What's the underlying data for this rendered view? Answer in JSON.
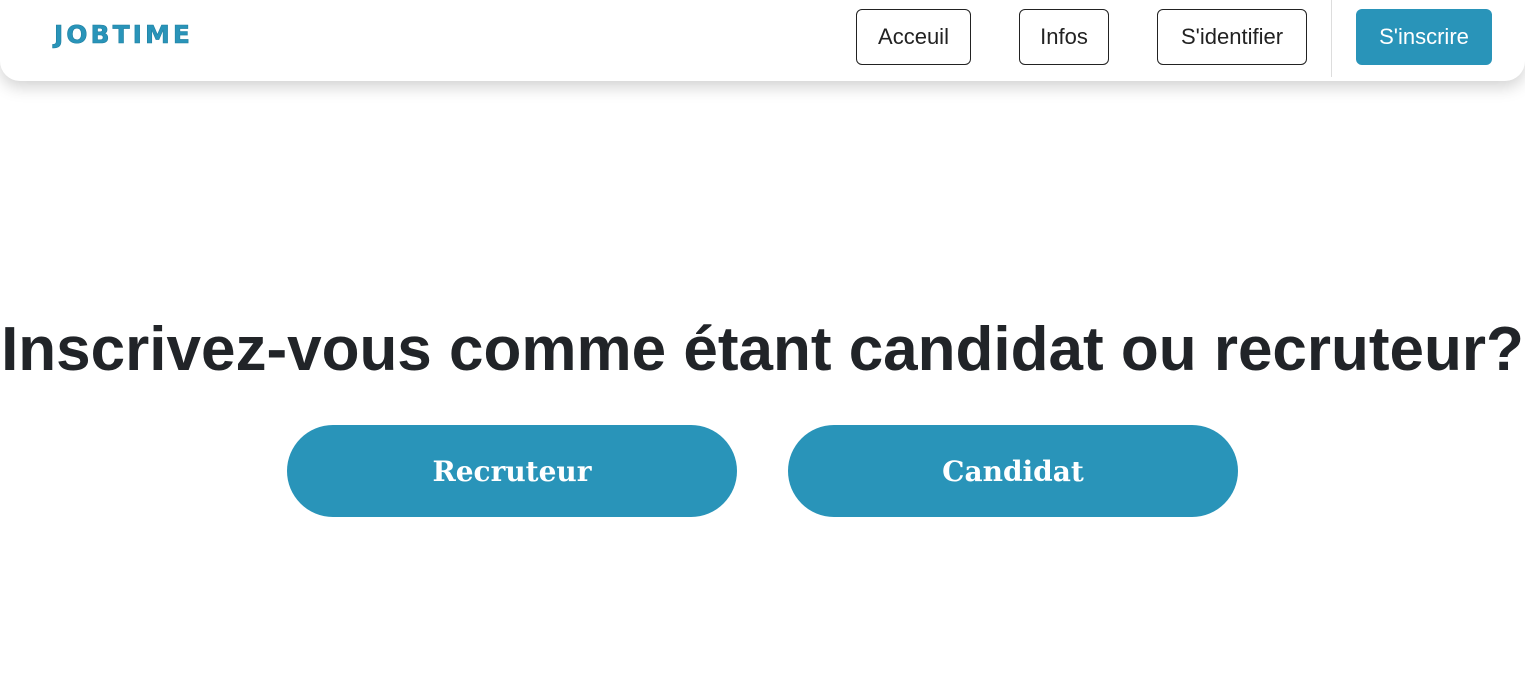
{
  "header": {
    "logo_text": "JOBTIME",
    "nav": {
      "acceuil_label": "Acceuil",
      "infos_label": "Infos",
      "identifier_label": "S'identifier",
      "inscrire_label": "S'inscrire"
    }
  },
  "main": {
    "headline": "Inscrivez-vous comme étant candidat ou recruteur?",
    "recruteur_label": "Recruteur",
    "candidat_label": "Candidat"
  },
  "colors": {
    "accent": "#2994b9",
    "headline_text": "#212428",
    "background": "#ffffff"
  }
}
